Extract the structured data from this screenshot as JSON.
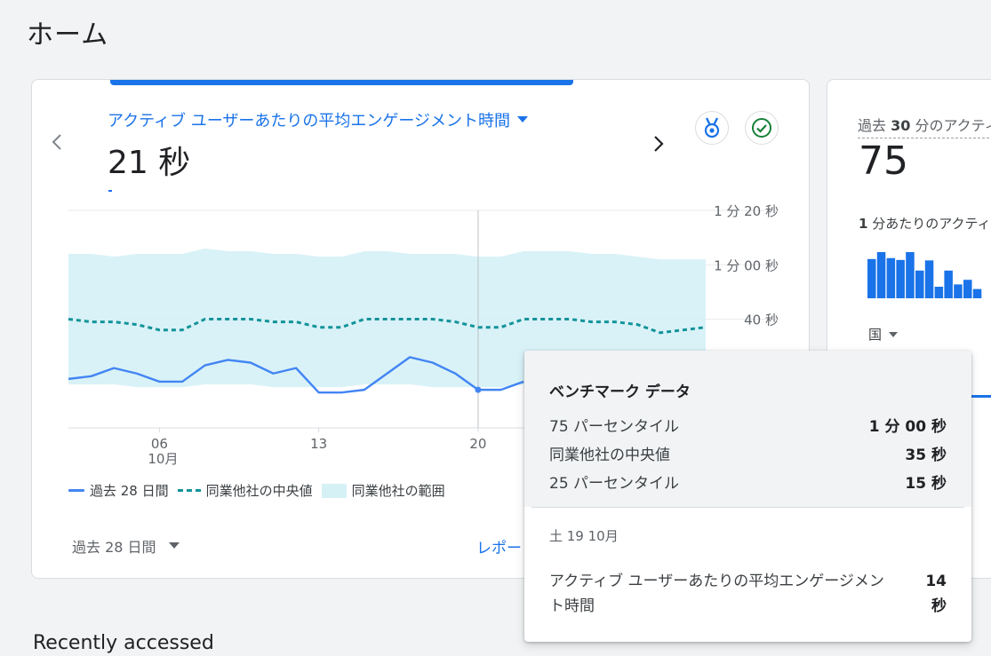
{
  "page": {
    "title": "ホーム"
  },
  "main_card": {
    "metric_label": "アクティブ ユーザーあたりの平均エンゲージメント時間",
    "metric_value": "21 秒",
    "date_range_label": "過去 28 日間",
    "report_link": "レポートのスナップショットを表示",
    "legend": {
      "series": "過去 28 日間",
      "median": "同業他社の中央値",
      "range": "同業他社の範囲"
    }
  },
  "chart_data": {
    "type": "line",
    "x_ticks": [
      {
        "day": "06",
        "month": "10月"
      },
      {
        "day": "13",
        "month": ""
      },
      {
        "day": "20",
        "month": ""
      }
    ],
    "y_ticks": [
      "1 分 20 秒",
      "1 分 00 秒",
      "40 秒"
    ],
    "ylim_seconds": [
      0,
      80
    ],
    "series": [
      {
        "name": "過去 28 日間",
        "color": "#4285f4",
        "values_seconds": [
          18,
          19,
          22,
          20,
          17,
          17,
          23,
          25,
          24,
          20,
          22,
          13,
          13,
          14,
          20,
          26,
          24,
          20,
          14,
          14,
          17
        ]
      },
      {
        "name": "同業他社の中央値",
        "color": "#12939a",
        "values_seconds": [
          40,
          39,
          39,
          38,
          36,
          36,
          40,
          40,
          40,
          39,
          39,
          37,
          37,
          40,
          40,
          40,
          40,
          39,
          37,
          37,
          40,
          40,
          40,
          39,
          39,
          38,
          35,
          36,
          37
        ]
      }
    ],
    "range": {
      "name": "同業他社の範囲",
      "color": "#d5f1f6",
      "upper_seconds": [
        64,
        64,
        63,
        64,
        64,
        64,
        66,
        65,
        65,
        64,
        64,
        63,
        63,
        65,
        65,
        64,
        64,
        64,
        63,
        63,
        65,
        65,
        65,
        64,
        64,
        63,
        62,
        62,
        62
      ],
      "lower_seconds": [
        16,
        16,
        16,
        15,
        15,
        15,
        16,
        16,
        16,
        15,
        15,
        15,
        15,
        16,
        16,
        16,
        15,
        15,
        15,
        15,
        16,
        16,
        16,
        15,
        15,
        15,
        15,
        15,
        15
      ]
    },
    "highlight_index": 18
  },
  "tooltip": {
    "title": "ベンチマーク データ",
    "rows": [
      {
        "label": "75 パーセンタイル",
        "value": "1 分 00 秒"
      },
      {
        "label": "同業他社の中央値",
        "value": "35 秒"
      },
      {
        "label": "25 パーセンタイル",
        "value": "15 秒"
      }
    ],
    "date": "土 19 10月",
    "metric_label": "アクティブ ユーザーあたりの平均エンゲージメント時間",
    "metric_value": "14 秒"
  },
  "side_card": {
    "title_prefix": "過去 ",
    "title_bold": "30",
    "title_suffix": " 分のアクティブ ユーザー",
    "value": "75",
    "sub_prefix": "1",
    "sub_suffix": " 分あたりのアクティブ ユーザー",
    "bars": [
      0.85,
      1.0,
      0.87,
      0.83,
      1.0,
      0.6,
      0.82,
      0.25,
      0.6,
      0.3,
      0.4,
      0.2
    ],
    "country_label": "国"
  },
  "recent": {
    "title": "Recently accessed"
  }
}
